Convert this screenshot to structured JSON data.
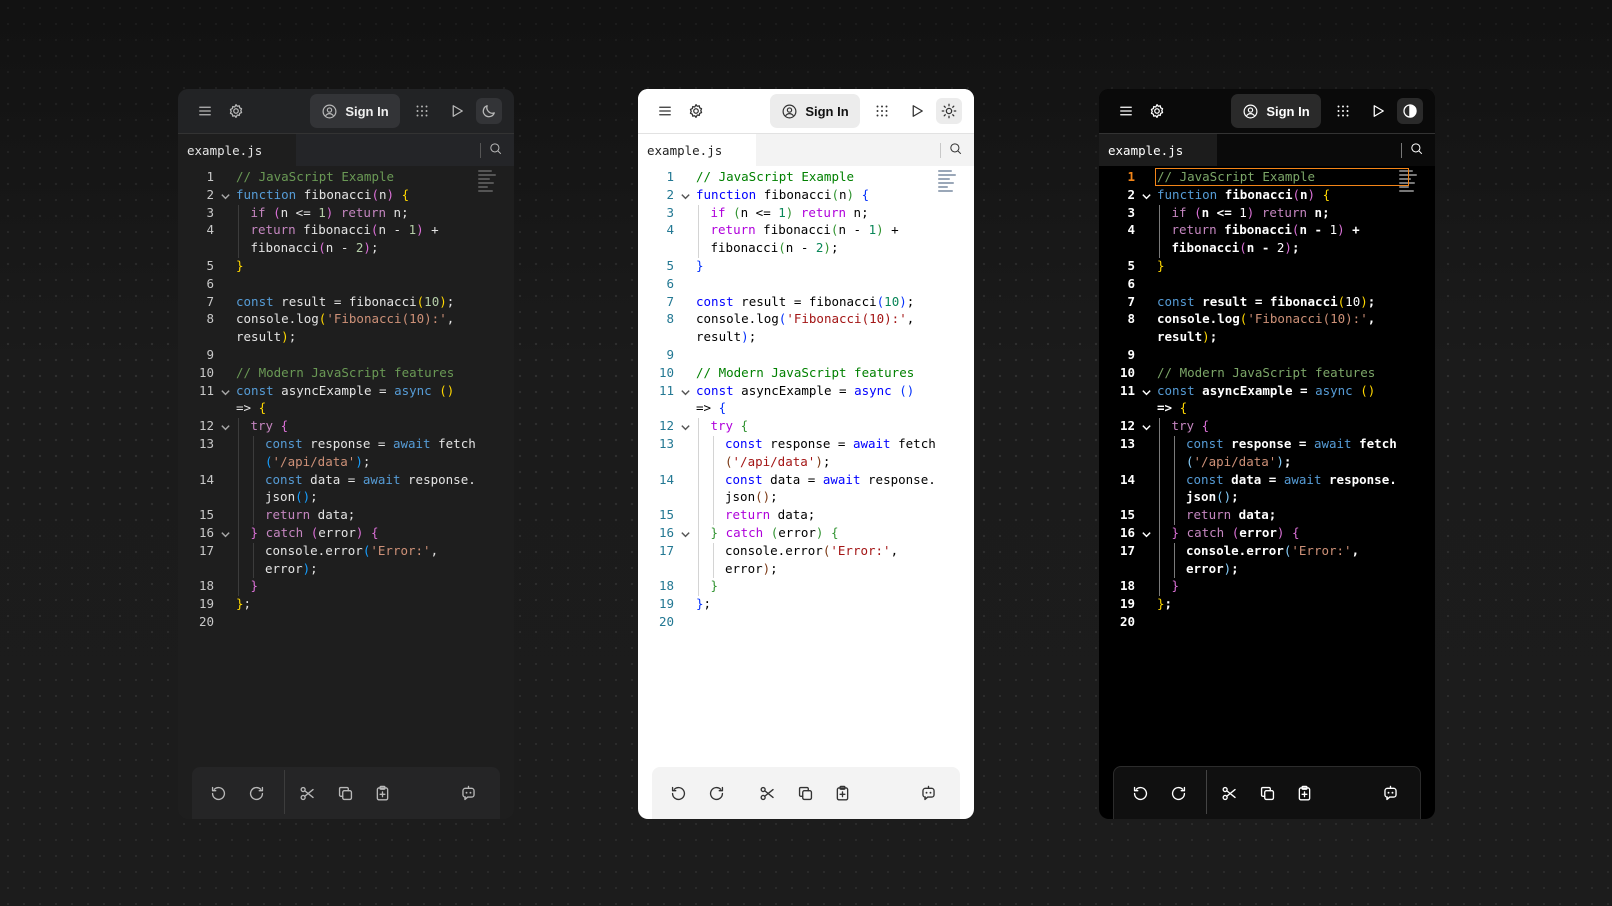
{
  "toolbar": {
    "signin_label": "Sign In"
  },
  "file_tab": {
    "name": "example.js"
  },
  "icons": {
    "menu": "menu-icon",
    "settings": "gear-icon",
    "account": "user-circle-icon",
    "apps": "grid-icon",
    "run": "play-icon",
    "theme_dark": "moon-icon",
    "theme_light": "sun-icon",
    "theme_contrast": "contrast-icon",
    "search": "search-icon",
    "undo": "undo-icon",
    "redo": "redo-icon",
    "cut": "scissors-icon",
    "copy": "copy-icon",
    "paste": "clipboard-icon",
    "assistant": "chat-bot-icon"
  },
  "panels": [
    {
      "theme": "dark"
    },
    {
      "theme": "light"
    },
    {
      "theme": "high-contrast"
    }
  ],
  "code": {
    "line_numbers": [
      "1",
      "2",
      "3",
      "4",
      "5",
      "6",
      "7",
      "8",
      "9",
      "10",
      "11",
      "12",
      "13",
      "14",
      "15",
      "16",
      "17",
      "18",
      "19",
      "20"
    ],
    "rows": [
      {
        "ln": 0,
        "fold": false,
        "tokens": [
          [
            "cm",
            "// JavaScript Example"
          ]
        ]
      },
      {
        "ln": 1,
        "fold": true,
        "tokens": [
          [
            "kw",
            "function"
          ],
          [
            "id",
            " fibonacci"
          ],
          [
            "b2",
            "("
          ],
          [
            "id",
            "n"
          ],
          [
            "b2",
            ")"
          ],
          [
            "id",
            " "
          ],
          [
            "b1",
            "{"
          ]
        ]
      },
      {
        "ln": 2,
        "fold": false,
        "indent": 1,
        "tokens": [
          [
            "ctl",
            "if"
          ],
          [
            "id",
            " "
          ],
          [
            "b2",
            "("
          ],
          [
            "id",
            "n <= "
          ],
          [
            "num",
            "1"
          ],
          [
            "b2",
            ")"
          ],
          [
            "id",
            " "
          ],
          [
            "ctl",
            "return"
          ],
          [
            "id",
            " n;"
          ]
        ]
      },
      {
        "ln": 3,
        "fold": false,
        "indent": 1,
        "tokens": [
          [
            "ctl",
            "return"
          ],
          [
            "id",
            " fibonacci"
          ],
          [
            "b2",
            "("
          ],
          [
            "id",
            "n - "
          ],
          [
            "num",
            "1"
          ],
          [
            "b2",
            ")"
          ],
          [
            "id",
            " +"
          ]
        ]
      },
      {
        "ln": -1,
        "fold": false,
        "indent": 1,
        "tokens": [
          [
            "id",
            "fibonacci"
          ],
          [
            "b2",
            "("
          ],
          [
            "id",
            "n - "
          ],
          [
            "num",
            "2"
          ],
          [
            "b2",
            ")"
          ],
          [
            "id",
            ";"
          ]
        ]
      },
      {
        "ln": 4,
        "fold": false,
        "tokens": [
          [
            "b1",
            "}"
          ]
        ]
      },
      {
        "ln": 5,
        "fold": false,
        "tokens": []
      },
      {
        "ln": 6,
        "fold": false,
        "tokens": [
          [
            "kw",
            "const"
          ],
          [
            "id",
            " result = fibonacci"
          ],
          [
            "b1",
            "("
          ],
          [
            "num",
            "10"
          ],
          [
            "b1",
            ")"
          ],
          [
            "id",
            ";"
          ]
        ]
      },
      {
        "ln": 7,
        "fold": false,
        "tokens": [
          [
            "id",
            "console.log"
          ],
          [
            "b1",
            "("
          ],
          [
            "str",
            "'Fibonacci(10):'"
          ],
          [
            "id",
            ","
          ]
        ]
      },
      {
        "ln": -1,
        "fold": false,
        "tokens": [
          [
            "id",
            "result"
          ],
          [
            "b1",
            ")"
          ],
          [
            "id",
            ";"
          ]
        ]
      },
      {
        "ln": 8,
        "fold": false,
        "tokens": []
      },
      {
        "ln": 9,
        "fold": false,
        "tokens": [
          [
            "cm",
            "// Modern JavaScript features"
          ]
        ]
      },
      {
        "ln": 10,
        "fold": true,
        "tokens": [
          [
            "kw",
            "const"
          ],
          [
            "id",
            " asyncExample = "
          ],
          [
            "kw",
            "async"
          ],
          [
            "id",
            " "
          ],
          [
            "b1",
            "()"
          ]
        ]
      },
      {
        "ln": -1,
        "fold": false,
        "tokens": [
          [
            "id",
            "=> "
          ],
          [
            "b1",
            "{"
          ]
        ]
      },
      {
        "ln": 11,
        "fold": true,
        "indent": 1,
        "tokens": [
          [
            "ctl",
            "try"
          ],
          [
            "id",
            " "
          ],
          [
            "b2",
            "{"
          ]
        ]
      },
      {
        "ln": 12,
        "fold": false,
        "indent": 2,
        "tokens": [
          [
            "kw",
            "const"
          ],
          [
            "id",
            " response = "
          ],
          [
            "kw",
            "await"
          ],
          [
            "id",
            " fetch"
          ]
        ]
      },
      {
        "ln": -1,
        "fold": false,
        "indent": 2,
        "tokens": [
          [
            "b3",
            "("
          ],
          [
            "str",
            "'/api/data'"
          ],
          [
            "b3",
            ")"
          ],
          [
            "id",
            ";"
          ]
        ]
      },
      {
        "ln": 13,
        "fold": false,
        "indent": 2,
        "tokens": [
          [
            "kw",
            "const"
          ],
          [
            "id",
            " data = "
          ],
          [
            "kw",
            "await"
          ],
          [
            "id",
            " response."
          ]
        ]
      },
      {
        "ln": -1,
        "fold": false,
        "indent": 2,
        "tokens": [
          [
            "id",
            "json"
          ],
          [
            "b3",
            "()"
          ],
          [
            "id",
            ";"
          ]
        ]
      },
      {
        "ln": 14,
        "fold": false,
        "indent": 2,
        "tokens": [
          [
            "ctl",
            "return"
          ],
          [
            "id",
            " data;"
          ]
        ]
      },
      {
        "ln": 15,
        "fold": true,
        "indent": 1,
        "tokens": [
          [
            "b2",
            "}"
          ],
          [
            "id",
            " "
          ],
          [
            "ctl",
            "catch"
          ],
          [
            "id",
            " "
          ],
          [
            "b2",
            "("
          ],
          [
            "id",
            "error"
          ],
          [
            "b2",
            ")"
          ],
          [
            "id",
            " "
          ],
          [
            "b2",
            "{"
          ]
        ]
      },
      {
        "ln": 16,
        "fold": false,
        "indent": 2,
        "tokens": [
          [
            "id",
            "console.error"
          ],
          [
            "b3",
            "("
          ],
          [
            "str",
            "'Error:'"
          ],
          [
            "id",
            ","
          ]
        ]
      },
      {
        "ln": -1,
        "fold": false,
        "indent": 2,
        "tokens": [
          [
            "id",
            "error"
          ],
          [
            "b3",
            ")"
          ],
          [
            "id",
            ";"
          ]
        ]
      },
      {
        "ln": 17,
        "fold": false,
        "indent": 1,
        "tokens": [
          [
            "b2",
            "}"
          ]
        ]
      },
      {
        "ln": 18,
        "fold": false,
        "tokens": [
          [
            "b1",
            "}"
          ],
          [
            "id",
            ";"
          ]
        ]
      },
      {
        "ln": 19,
        "fold": false,
        "tokens": []
      }
    ]
  }
}
